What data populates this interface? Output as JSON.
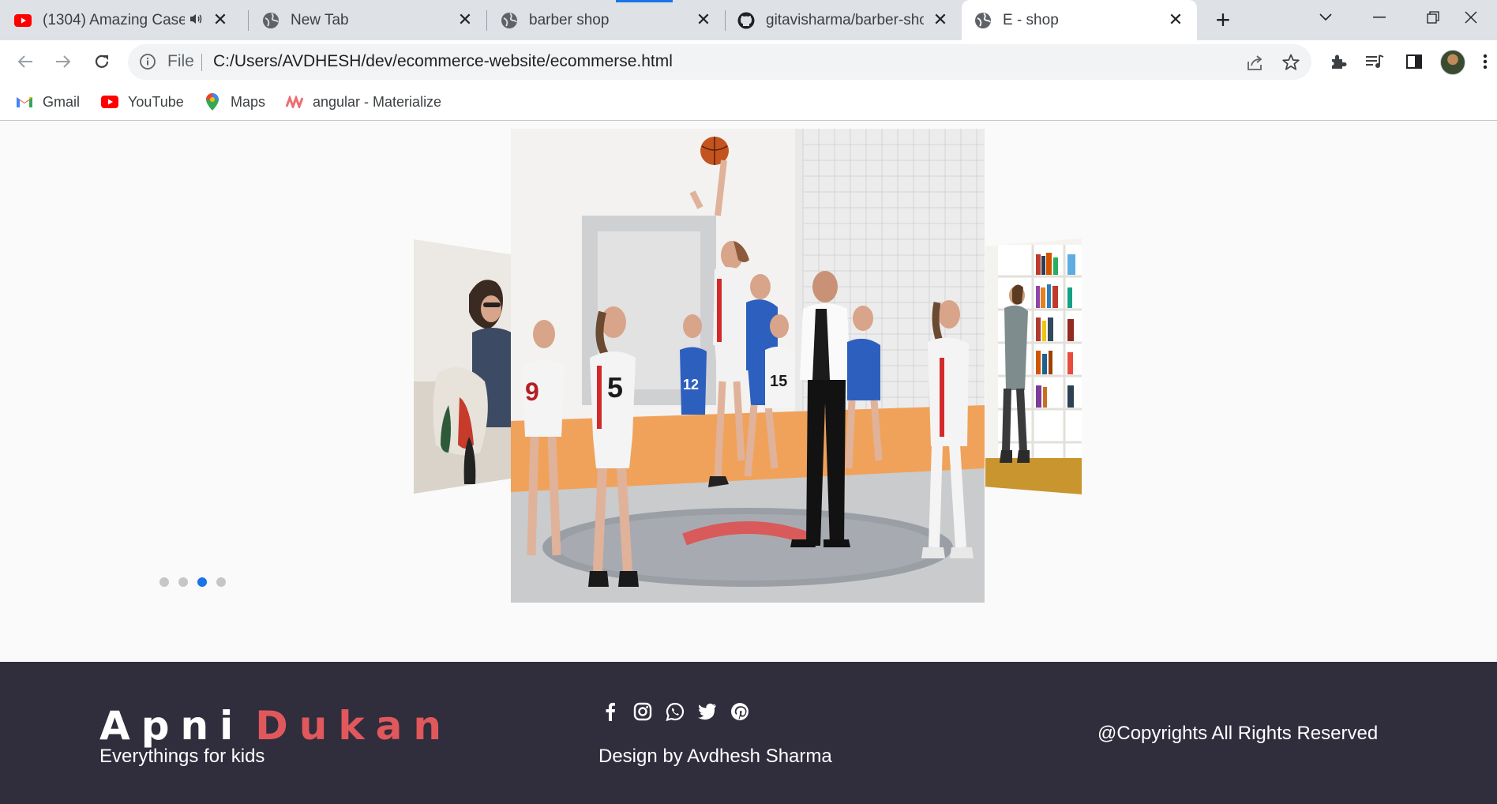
{
  "browser": {
    "tabs": [
      {
        "title": "(1304) Amazing Case",
        "favicon": "youtube-icon",
        "active": false,
        "audio": true
      },
      {
        "title": "New Tab",
        "favicon": "globe-icon",
        "active": false
      },
      {
        "title": "barber shop",
        "favicon": "globe-icon",
        "active": false,
        "loading": true
      },
      {
        "title": "gitavisharma/barber-shop",
        "favicon": "github-icon",
        "active": false
      },
      {
        "title": "E - shop",
        "favicon": "globe-icon",
        "active": true
      }
    ],
    "address": {
      "scheme_label": "File",
      "url": "C:/Users/AVDHESH/dev/ecommerce-website/ecommerse.html"
    },
    "bookmarks": [
      {
        "label": "Gmail",
        "icon": "gmail-icon"
      },
      {
        "label": "YouTube",
        "icon": "youtube-icon"
      },
      {
        "label": "Maps",
        "icon": "maps-pin-icon"
      },
      {
        "label": "angular - Materialize",
        "icon": "materialize-icon"
      }
    ]
  },
  "carousel": {
    "slides": [
      {
        "name": "fashion-woman",
        "position": "left"
      },
      {
        "name": "basketball-game",
        "position": "center"
      },
      {
        "name": "library-bookshelf",
        "position": "right"
      }
    ],
    "dot_count": 4,
    "active_dot": 3,
    "colors": {
      "active_dot": "#1a73e8",
      "dot": "#c6c6c6"
    }
  },
  "footer": {
    "brand_first": "Apni",
    "brand_second": "Dukan",
    "tagline": "Everythings for kids",
    "socials": [
      "facebook-icon",
      "instagram-icon",
      "whatsapp-icon",
      "twitter-icon",
      "pinterest-icon"
    ],
    "designer": "Design by Avdhesh Sharma",
    "copyright": "@Copyrights All Rights Reserved",
    "colors": {
      "background": "#302d3d",
      "brand_accent": "#e0585b"
    }
  }
}
